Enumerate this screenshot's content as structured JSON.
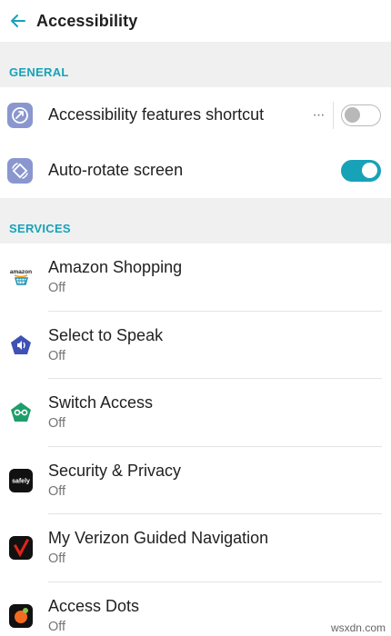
{
  "appbar": {
    "title": "Accessibility"
  },
  "general": {
    "header": "GENERAL",
    "items": [
      {
        "label": "Accessibility features shortcut",
        "icon": "shortcut-icon",
        "toggle": false,
        "has_more": true,
        "more_glyph": "···"
      },
      {
        "label": "Auto-rotate screen",
        "icon": "auto-rotate-icon",
        "toggle": true
      }
    ]
  },
  "services": {
    "header": "SERVICES",
    "items": [
      {
        "title": "Amazon Shopping",
        "status": "Off",
        "icon": "amazon-icon",
        "icon_text": "amazon"
      },
      {
        "title": "Select to Speak",
        "status": "Off",
        "icon": "select-to-speak-icon"
      },
      {
        "title": "Switch Access",
        "status": "Off",
        "icon": "switch-access-icon"
      },
      {
        "title": "Security & Privacy",
        "status": "Off",
        "icon": "safely-icon",
        "icon_text": "safely"
      },
      {
        "title": "My Verizon Guided Navigation",
        "status": "Off",
        "icon": "verizon-icon"
      },
      {
        "title": "Access Dots",
        "status": "Off",
        "icon": "access-dots-icon"
      }
    ]
  },
  "watermark": "wsxdn.com",
  "colors": {
    "accent": "#17a2b8",
    "section_bg": "#f0f0f0",
    "toggle_off": "#b8b8b8"
  }
}
